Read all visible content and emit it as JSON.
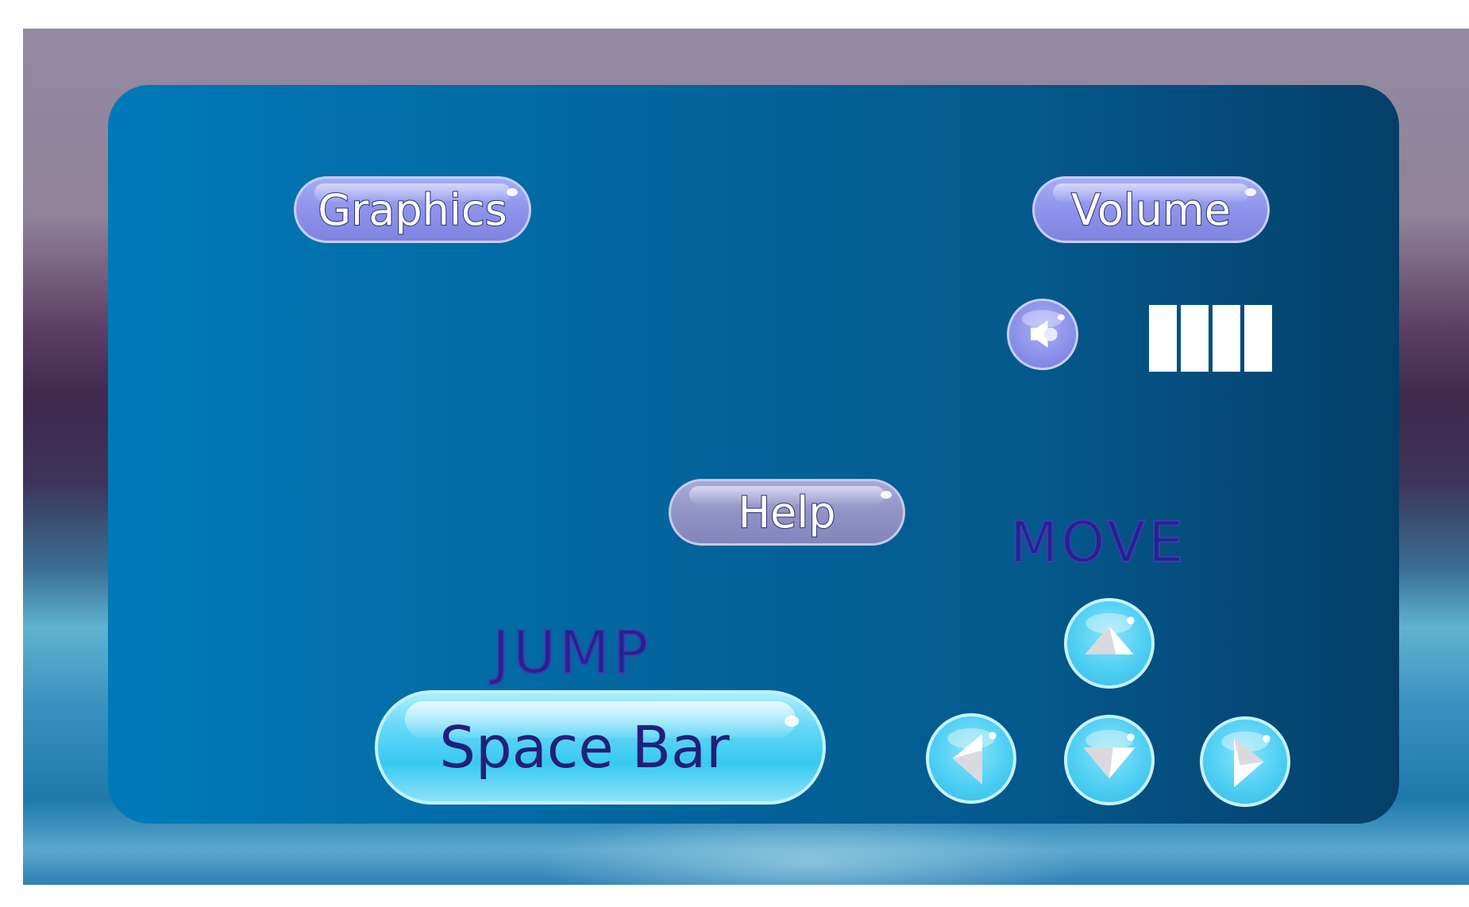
{
  "settings": {
    "graphics_label": "Graphics",
    "volume_label": "Volume",
    "help_label": "Help"
  },
  "volume": {
    "level": 4,
    "max": 4,
    "mute_icon": "speaker-icon"
  },
  "controls": {
    "move_heading": "MOVE",
    "jump_heading": "JUMP",
    "jump_key_label": "Space Bar",
    "arrow_icons": [
      "arrow-up-icon",
      "arrow-left-icon",
      "arrow-down-icon",
      "arrow-right-icon"
    ]
  },
  "colors": {
    "panel": "#0179b9",
    "pill_violet": "#8e93ea",
    "pill_cyan": "#38c9f2",
    "heading_text": "#25238a"
  }
}
